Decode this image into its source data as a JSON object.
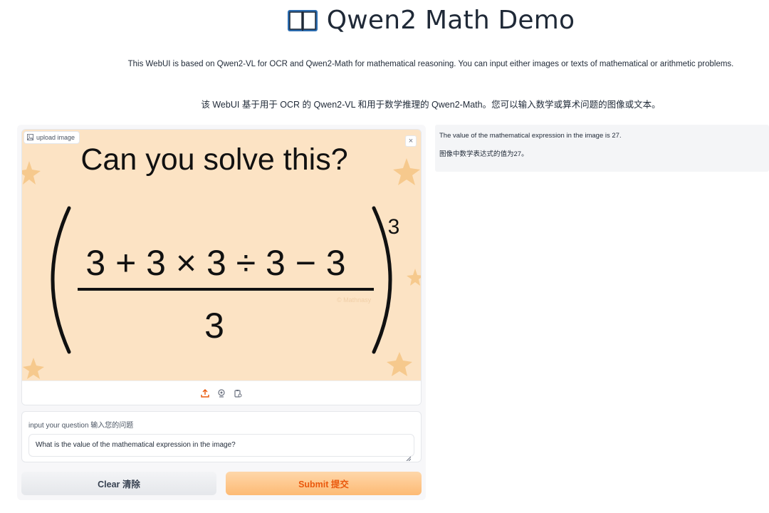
{
  "header": {
    "title": "Qwen2 Math Demo",
    "icon": "open-book-icon"
  },
  "description": {
    "english": "This WebUI is based on Qwen2-VL for OCR and Qwen2-Math for mathematical reasoning. You can input either images or texts of mathematical or arithmetic problems.",
    "chinese": "该 WebUI 基于用于 OCR 的 Qwen2-VL 和用于数学推理的 Qwen2-Math。您可以输入数学或算术问题的图像或文本。"
  },
  "image_input": {
    "label": "upload image",
    "close_symbol": "×",
    "sources": [
      "upload-icon",
      "webcam-icon",
      "clipboard-icon"
    ],
    "image": {
      "heading": "Can you solve this?",
      "numerator": "3 + 3 × 3 ÷ 3 − 3",
      "denominator": "3",
      "exponent": "3",
      "watermark": "© Mathnasy",
      "background_color": "#fce3c4"
    }
  },
  "question": {
    "label": "input your question 输入您的问题",
    "value": "What is the value of the mathematical expression in the image?"
  },
  "buttons": {
    "clear": "Clear 清除",
    "submit": "Submit 提交"
  },
  "output": {
    "english": "The value of the mathematical expression in the image is 27.",
    "chinese": "图像中数学表达式的值为27。"
  },
  "colors": {
    "submit_text": "#ea580c",
    "submit_bg": "#fdba74",
    "image_bg": "#fce3c4"
  }
}
